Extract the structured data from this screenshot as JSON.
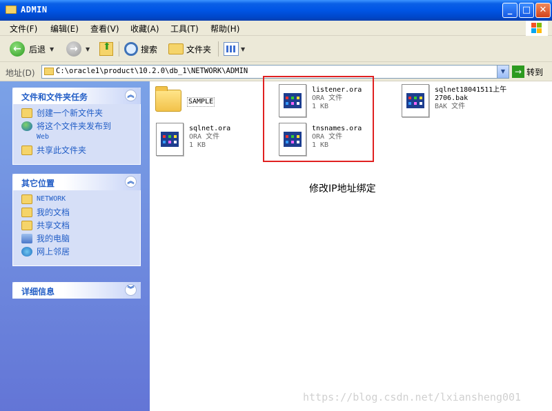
{
  "window": {
    "title": "ADMIN",
    "buttons": {
      "minimize": "_",
      "maximize": "□",
      "close": "✕"
    }
  },
  "menu": [
    "文件(F)",
    "编辑(E)",
    "查看(V)",
    "收藏(A)",
    "工具(T)",
    "帮助(H)"
  ],
  "toolbar": {
    "back_label": "后退",
    "search_label": "搜索",
    "folders_label": "文件夹"
  },
  "address": {
    "label": "地址(D)",
    "value": "C:\\oracle1\\product\\10.2.0\\db_1\\NETWORK\\ADMIN",
    "go_label": "转到"
  },
  "tasks_panel": {
    "title": "文件和文件夹任务",
    "items": [
      "创建一个新文件夹",
      "将这个文件夹发布到",
      "Web",
      "共享此文件夹"
    ]
  },
  "places_panel": {
    "title": "其它位置",
    "items": [
      "NETWORK",
      "我的文档",
      "共享文档",
      "我的电脑",
      "网上邻居"
    ]
  },
  "details_panel": {
    "title": "详细信息"
  },
  "files": [
    {
      "name": "SAMPLE",
      "type": "",
      "size": ""
    },
    {
      "name": "listener.ora",
      "type": "ORA 文件",
      "size": "1 KB"
    },
    {
      "name": "sqlnet18041511上午",
      "name2": "2706.bak",
      "type": "BAK 文件",
      "size": ""
    },
    {
      "name": "sqlnet.ora",
      "type": "ORA 文件",
      "size": "1 KB"
    },
    {
      "name": "tnsnames.ora",
      "type": "ORA 文件",
      "size": "1 KB"
    }
  ],
  "annotation": "修改IP地址绑定",
  "watermark": "https://blog.csdn.net/lxiansheng001",
  "colors": {
    "titlebar": "#0055e5",
    "highlight_box": "#e02020",
    "task_pane": "#7ba2e7",
    "link": "#215dc6"
  }
}
